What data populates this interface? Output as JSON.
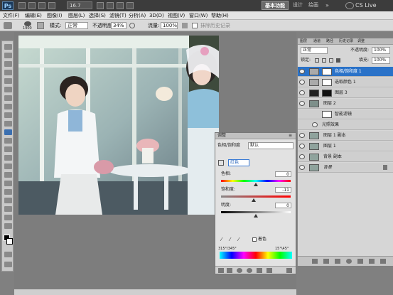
{
  "titlebar": {
    "logo": "Ps",
    "zoom": "16.7",
    "workspace": "基本功能",
    "links": [
      "设计",
      "绘画"
    ],
    "cs_live": "CS Live"
  },
  "menu": [
    "文件(F)",
    "编辑(E)",
    "图像(I)",
    "图层(L)",
    "选择(S)",
    "滤镜(T)",
    "分析(A)",
    "3D(D)",
    "视图(V)",
    "窗口(W)",
    "帮助(H)"
  ],
  "options": {
    "size": "1900",
    "mode_label": "模式:",
    "mode_value": "正常",
    "opacity_label": "不透明度:",
    "opacity_value": "34%",
    "flow_label": "流量:",
    "flow_value": "100%",
    "history_label": "抹除历史记录"
  },
  "layers": {
    "tabs": [
      "图层",
      "通道",
      "路径",
      "历史记录",
      "调整"
    ],
    "blend_mode": "正常",
    "opacity_label": "不透明度:",
    "opacity": "100%",
    "lock_label": "锁定:",
    "fill_label": "填充:",
    "fill": "100%",
    "rows": [
      {
        "name": "色相/饱和度 1"
      },
      {
        "name": "选取颜色 1"
      },
      {
        "name": "图层 3"
      },
      {
        "name": "图层 2"
      },
      {
        "name": "智能滤镜"
      },
      {
        "name": "光照效果"
      },
      {
        "name": "图层 1 副本"
      },
      {
        "name": "图层 1"
      },
      {
        "name": "背景 副本"
      },
      {
        "name": "背景"
      }
    ]
  },
  "adjust": {
    "title": "调整",
    "type": "色相/饱和度",
    "preset": "默认",
    "channel": "红色",
    "hue_label": "色相:",
    "hue": "0",
    "hue_level": 0.5,
    "sat_label": "饱和度:",
    "sat": "-11",
    "sat_level": 0.47,
    "light_label": "明度:",
    "light": "0",
    "light_level": 0.5,
    "colorize_label": "着色",
    "range_left": "315°/345°",
    "range_right": "15°\\45°"
  }
}
